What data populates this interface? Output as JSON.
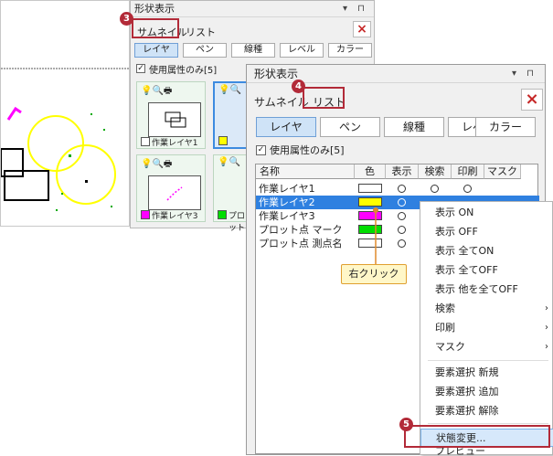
{
  "back_panel": {
    "title": "形状表示",
    "pin_glyphs": "▾ ⊓",
    "tabs": [
      "サムネイル",
      "リスト"
    ],
    "close_label": "×",
    "segments": [
      "レイヤ",
      "ペン",
      "線種",
      "レベル",
      "カラー"
    ],
    "filter_label": "使用属性のみ[5]",
    "thumbnails": [
      {
        "label": "作業レイヤ1",
        "color": "#ffffff"
      },
      {
        "label": "",
        "color": "#ffff00"
      },
      {
        "label": "作業レイヤ3",
        "color": "#ff00ff"
      },
      {
        "label": "プロット",
        "color": "#00dd00"
      }
    ]
  },
  "front_panel": {
    "title": "形状表示",
    "pin_glyphs": "▾ ⊓",
    "tabs": [
      "サムネイル",
      "リスト"
    ],
    "close_label": "×",
    "segments": [
      "レイヤ",
      "ペン",
      "線種",
      "レベル",
      "カラー"
    ],
    "filter_label": "使用属性のみ[5]",
    "columns": [
      "名称",
      "色",
      "表示",
      "検索",
      "印刷",
      "マスク"
    ],
    "rows": [
      {
        "name": "作業レイヤ1",
        "color": "#ffffff"
      },
      {
        "name": "作業レイヤ2",
        "color": "#ffff00"
      },
      {
        "name": "作業レイヤ3",
        "color": "#ff00ff"
      },
      {
        "name": "プロット点 マーク",
        "color": "#00dd00"
      },
      {
        "name": "プロット点 測点名",
        "color": "#ffffff"
      }
    ],
    "circle_glyph": "○"
  },
  "context_menu": {
    "items": [
      "表示 ON",
      "表示 OFF",
      "表示 全てON",
      "表示 全てOFF",
      "表示 他を全てOFF",
      "検索",
      "印刷",
      "マスク",
      "要素選択 新規",
      "要素選択 追加",
      "要素選択 解除",
      "状態変更...",
      "プレビュー"
    ],
    "submenu_arrow": "›"
  },
  "callouts": {
    "badges": [
      "3",
      "4",
      "5"
    ],
    "tooltip": "右クリック"
  },
  "colors": {
    "accent": "#b22a38",
    "selection": "#2f80e0"
  }
}
